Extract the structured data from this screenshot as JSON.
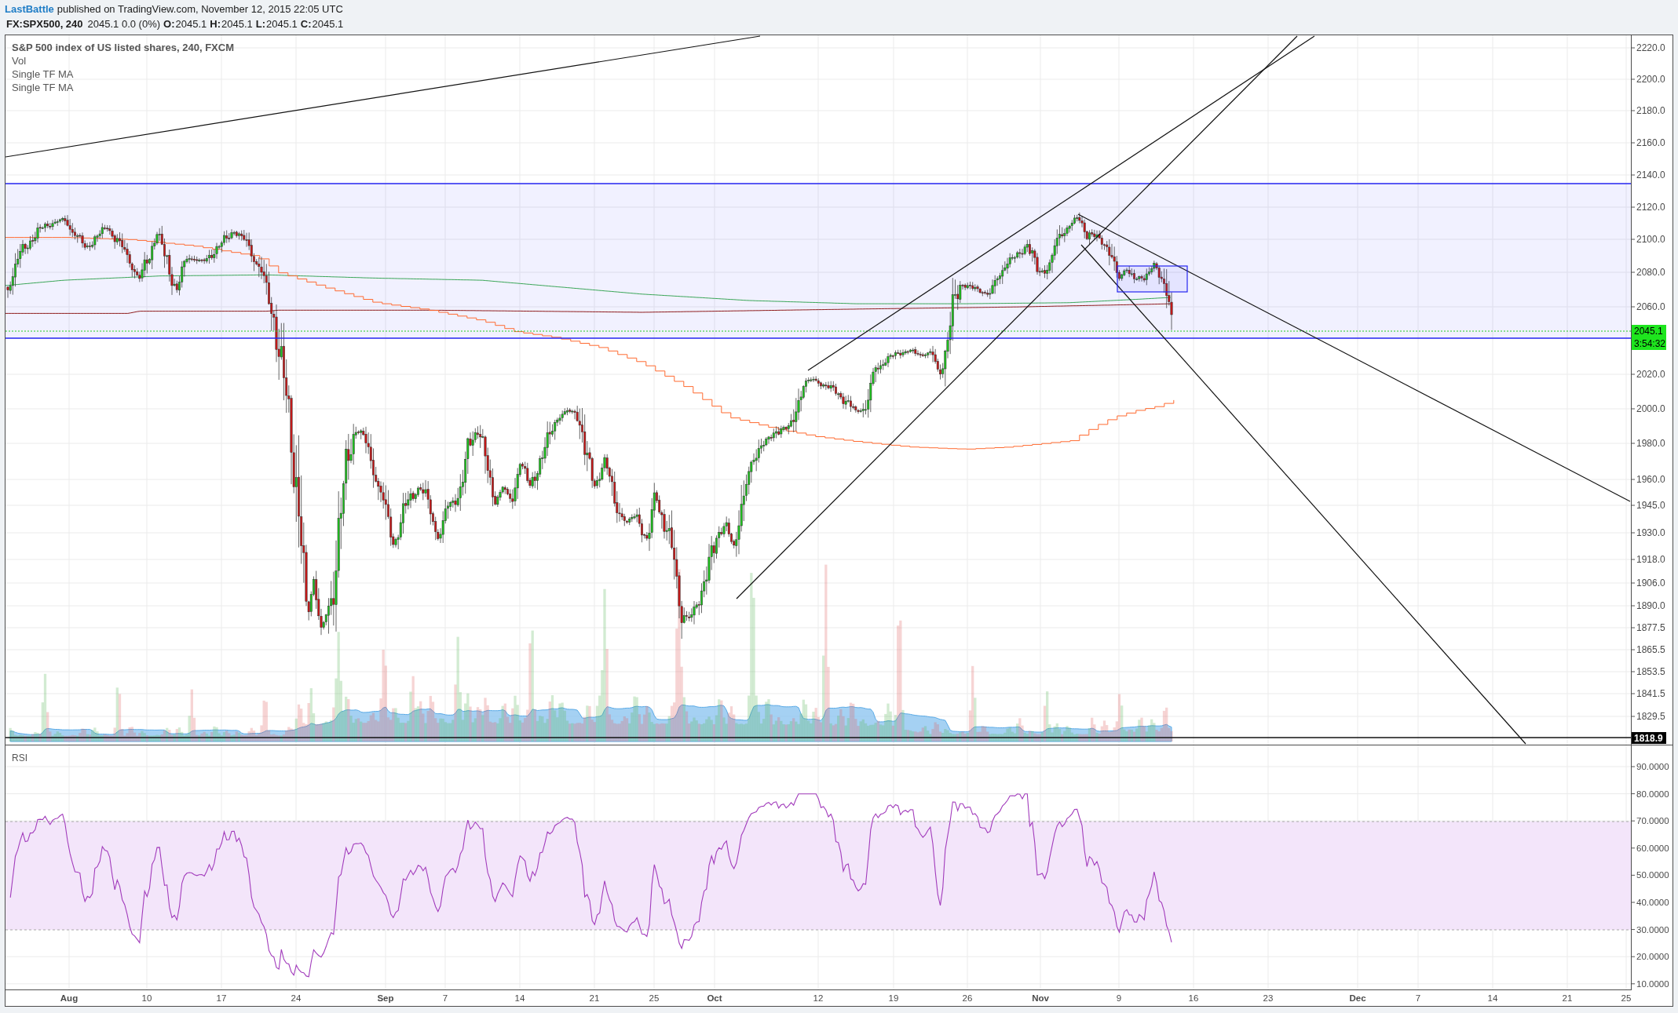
{
  "header": {
    "author": "LastBattle",
    "published": "published on TradingView.com, November 12, 2015 22:05 UTC",
    "symbol": "FX:SPX500, 240",
    "change": "2045.1 0.0 (0%)",
    "ohlc": [
      {
        "label": "O:",
        "value": "2045.1"
      },
      {
        "label": "H:",
        "value": "2045.1"
      },
      {
        "label": "L:",
        "value": "2045.1"
      },
      {
        "label": "C:",
        "value": "2045.1"
      }
    ]
  },
  "legend": {
    "title": "S&P 500 index of US listed shares, 240, FXCM",
    "studies": [
      "Vol",
      "Single TF MA",
      "Single TF MA"
    ]
  },
  "price_axis": {
    "labels": [
      "2220.0",
      "2200.0",
      "2180.0",
      "2160.0",
      "2140.0",
      "2120.0",
      "2100.0",
      "2080.0",
      "2060.0",
      "2020.0",
      "2000.0",
      "1980.0",
      "1960.0",
      "1945.0",
      "1930.0",
      "1918.0",
      "1906.0",
      "1890.0",
      "1877.5",
      "1865.5",
      "1853.5",
      "1841.5",
      "1829.5"
    ],
    "last_price": "2045.1",
    "countdown": "3:54:32",
    "line_price": "1818.9"
  },
  "rsi_pane": {
    "title": "RSI",
    "axis_labels": [
      "90.0000",
      "80.0000",
      "70.0000",
      "60.0000",
      "50.0000",
      "40.0000",
      "30.0000",
      "20.0000",
      "10.0000"
    ]
  },
  "date_axis": {
    "labels": [
      {
        "text": "Aug",
        "kind": "month"
      },
      {
        "text": "10",
        "kind": "day"
      },
      {
        "text": "17",
        "kind": "day"
      },
      {
        "text": "24",
        "kind": "day"
      },
      {
        "text": "Sep",
        "kind": "month"
      },
      {
        "text": "7",
        "kind": "day"
      },
      {
        "text": "14",
        "kind": "day"
      },
      {
        "text": "21",
        "kind": "day"
      },
      {
        "text": "25",
        "kind": "day"
      },
      {
        "text": "Oct",
        "kind": "month"
      },
      {
        "text": "12",
        "kind": "day"
      },
      {
        "text": "19",
        "kind": "day"
      },
      {
        "text": "26",
        "kind": "day"
      },
      {
        "text": "Nov",
        "kind": "month"
      },
      {
        "text": "9",
        "kind": "day"
      },
      {
        "text": "16",
        "kind": "day"
      },
      {
        "text": "23",
        "kind": "day"
      },
      {
        "text": "Dec",
        "kind": "month"
      },
      {
        "text": "7",
        "kind": "day"
      },
      {
        "text": "14",
        "kind": "day"
      },
      {
        "text": "21",
        "kind": "day"
      },
      {
        "text": "25",
        "kind": "day"
      }
    ]
  }
}
